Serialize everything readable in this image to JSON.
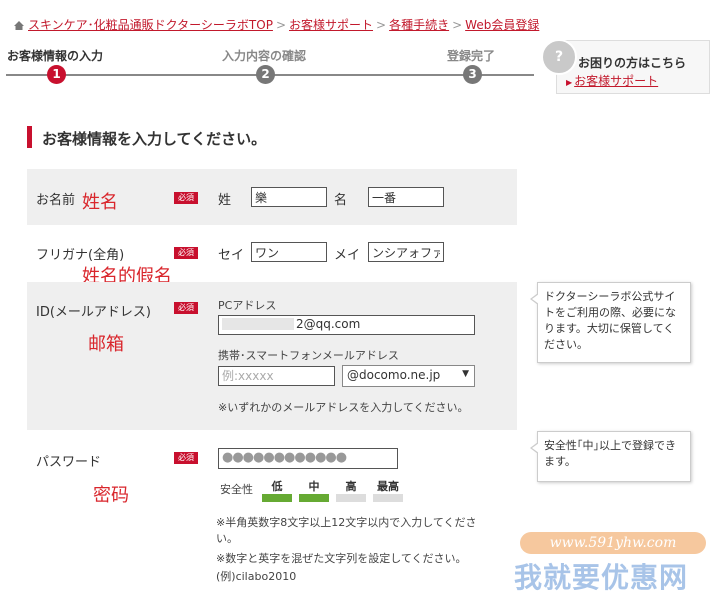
{
  "breadcrumb": {
    "items": [
      "スキンケア･化粧品通販ドクターシーラボTOP",
      "お客様サポート",
      "各種手続き"
    ],
    "current": "Web会員登録",
    "separator": ">"
  },
  "steps": [
    {
      "num": "1",
      "label": "お客様情報の入力",
      "active": true
    },
    {
      "num": "2",
      "label": "入力内容の確認",
      "active": false
    },
    {
      "num": "3",
      "label": "登録完了",
      "active": false
    }
  ],
  "help": {
    "title": "お困りの方はこちら",
    "link": "お客様サポート"
  },
  "heading": "お客様情報を入力してください。",
  "required_label": "必須",
  "name": {
    "label": "お名前",
    "annotation": "姓名",
    "sei_label": "姓",
    "sei_value": "樂",
    "mei_label": "名",
    "mei_value": "一番"
  },
  "furigana": {
    "label": "フリガナ(全角)",
    "annotation": "姓名的假名",
    "sei_label": "セイ",
    "sei_value": "ワン",
    "mei_label": "メイ",
    "mei_value": "ンシアォファ"
  },
  "email": {
    "label": "ID(メールアドレス)",
    "annotation": "邮箱",
    "pc_label": "PCアドレス",
    "pc_value": "2@qq.com",
    "mobile_label": "携帯･スマートフォンメールアドレス",
    "mobile_placeholder": "例:xxxxx",
    "domain_selected": "@docomo.ne.jp",
    "note": "※いずれかのメールアドレスを入力してください。",
    "tip": "ドクターシーラボ公式サイトをご利用の際、必要になります。大切に保管してください。"
  },
  "password": {
    "label": "パスワード",
    "annotation": "密码",
    "masked": "●●●●●●●●●●●●",
    "strength_label": "安全性",
    "levels": [
      "低",
      "中",
      "高",
      "最高"
    ],
    "strength_level": 2,
    "colors": {
      "on": "#66aa33",
      "off": "#dddddd"
    },
    "tip": "安全性｢中｣以上で登録できます。",
    "note1": "※半角英数字8文字以上12文字以内で入力してください。",
    "note2": "※数字と英字を混ぜた文字列を設定してください。",
    "note3": "(例)cilabo2010"
  },
  "watermark": {
    "url": "www.591yhw.com",
    "name": "我就要优惠网"
  },
  "colors": {
    "accent": "#c8102e",
    "link": "#c2192c",
    "row_bg": "#efefef"
  }
}
